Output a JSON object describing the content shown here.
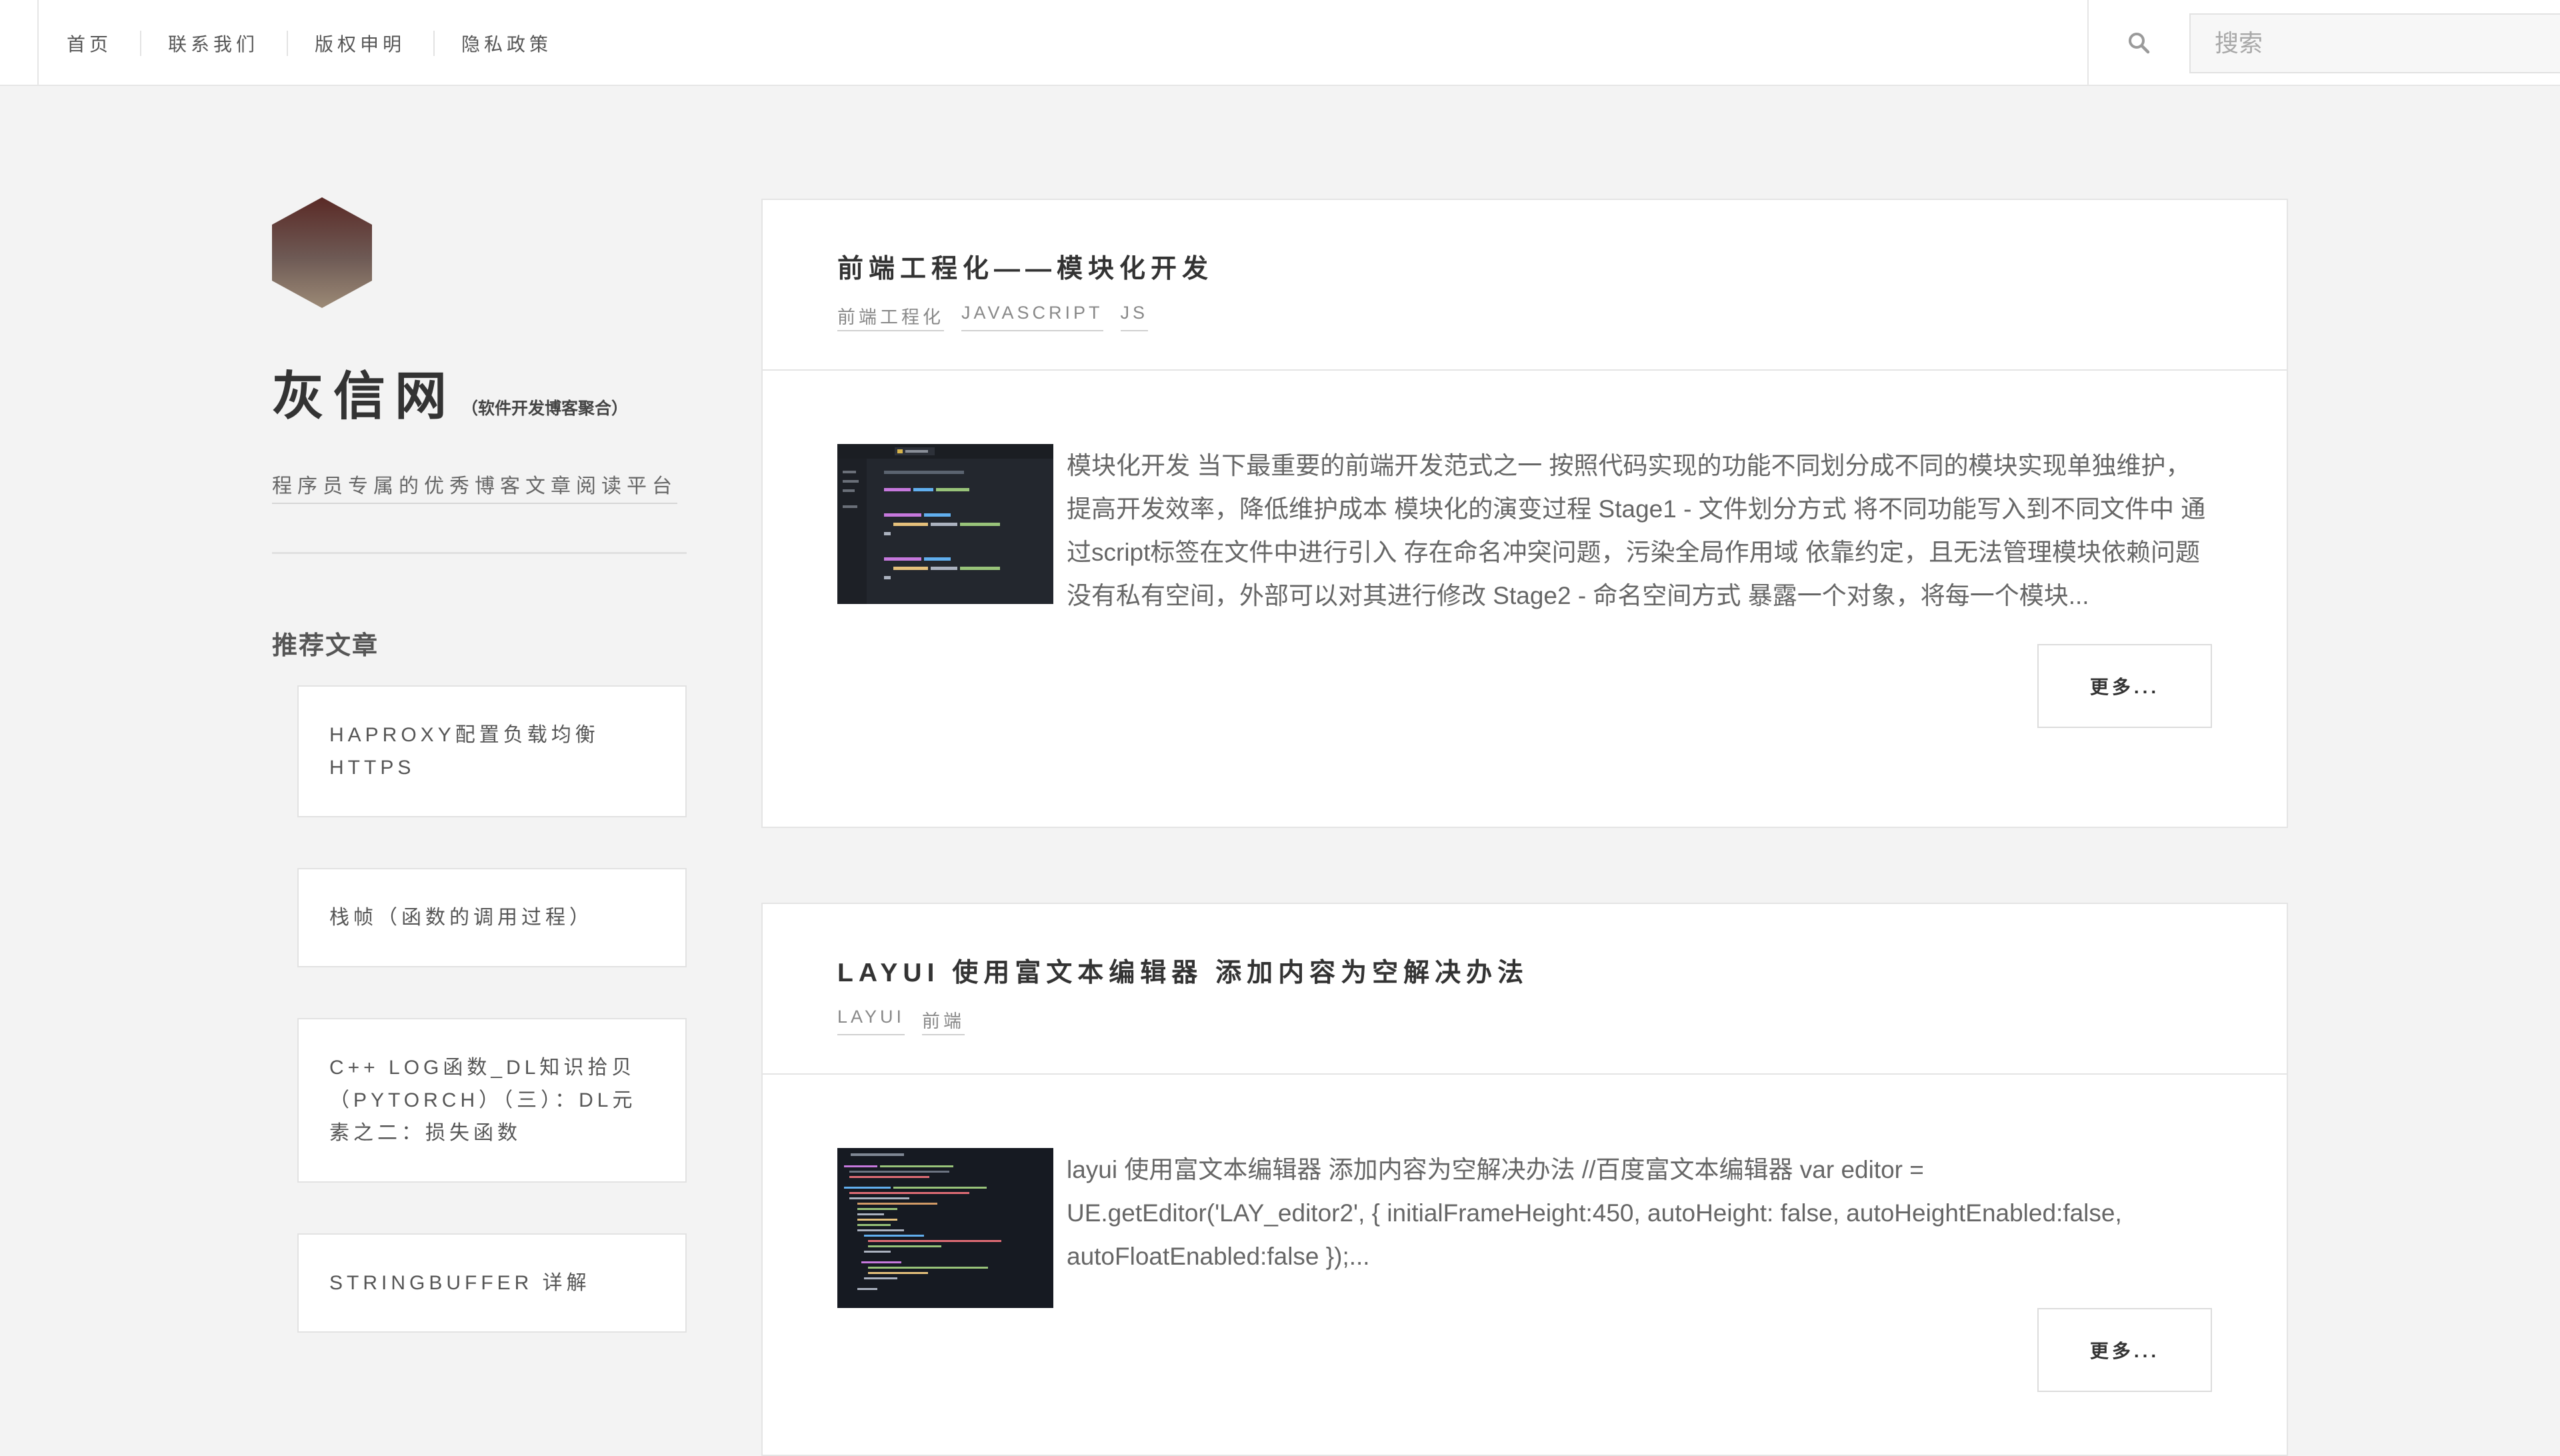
{
  "nav": {
    "items": [
      "首页",
      "联系我们",
      "版权申明",
      "隐私政策"
    ],
    "search_placeholder": "搜索"
  },
  "site": {
    "title": "灰信网",
    "subtitle": "（软件开发博客聚合）",
    "tagline": "程序员专属的优秀博客文章阅读平台"
  },
  "sidebar": {
    "heading": "推荐文章",
    "items": [
      "HAPROXY配置负载均衡HTTPS",
      "栈帧（函数的调用过程）",
      "C++ LOG函数_DL知识拾贝（PYTORCH）（三）：DL元素之二：损失函数",
      "STRINGBUFFER 详解"
    ]
  },
  "posts": [
    {
      "title": "前端工程化——模块化开发",
      "tags": [
        "前端工程化",
        "JAVASCRIPT",
        "JS"
      ],
      "excerpt": "模块化开发 当下最重要的前端开发范式之一 按照代码实现的功能不同划分成不同的模块实现单独维护，提高开发效率，降低维护成本 模块化的演变过程 Stage1 - 文件划分方式 将不同功能写入到不同文件中 通过script标签在文件中进行引入 存在命名冲突问题，污染全局作用域 依靠约定，且无法管理模块依赖问题 没有私有空间，外部可以对其进行修改 Stage2 - 命名空间方式 暴露一个对象，将每一个模块...",
      "more": "更多..."
    },
    {
      "title": "LAYUI 使用富文本编辑器 添加内容为空解决办法",
      "tags": [
        "LAYUI",
        "前端"
      ],
      "excerpt": "layui 使用富文本编辑器 添加内容为空解决办法 //百度富文本编辑器 var editor = UE.getEditor('LAY_editor2', { initialFrameHeight:450, autoHeight: false, autoHeightEnabled:false, autoFloatEnabled:false });...",
      "more": "更多..."
    }
  ]
}
